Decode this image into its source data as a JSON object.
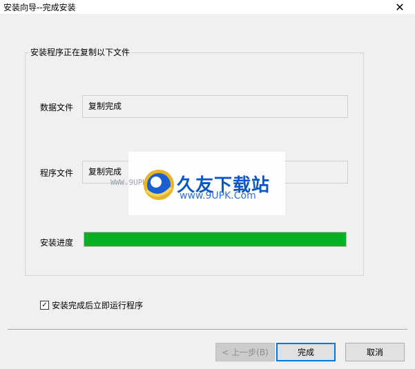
{
  "window": {
    "title": "安装向导--完成安装",
    "close_symbol": "✕"
  },
  "group": {
    "title": "安装程序正在复制以下文件"
  },
  "rows": {
    "data_label": "数据文件",
    "data_value": "复制完成",
    "program_label": "程序文件",
    "program_value": "复制完成",
    "progress_label": "安装进度",
    "progress_fraction": 1.0
  },
  "checkbox": {
    "label": "安装完成后立即运行程序",
    "checked": true,
    "check_symbol": "✓"
  },
  "buttons": {
    "back_label": "< 上一步(B)",
    "finish_label": "完成",
    "cancel_label": "取消"
  },
  "watermark": {
    "brand": "久友下载站",
    "url": "www.9UPK.Com",
    "small_text": "WWW.9UPK.COM"
  },
  "colors": {
    "progress_fill": "#06b025",
    "default_button_border": "#0078d7",
    "watermark_blue": "#0a56c4"
  },
  "icons": {
    "close": "close-icon",
    "check": "check-icon",
    "watermark_logo": "watermark-logo-icon"
  }
}
